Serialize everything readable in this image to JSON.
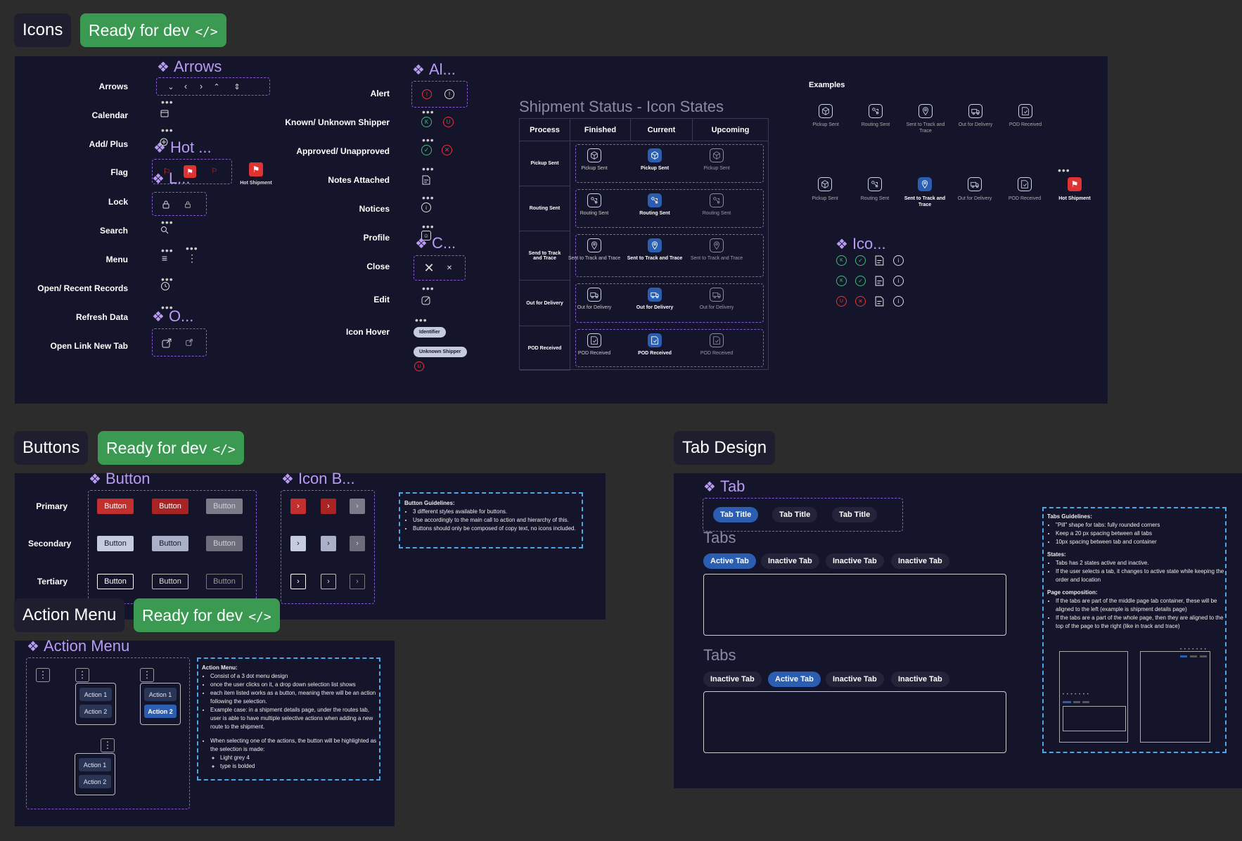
{
  "sections": {
    "icons": {
      "title": "Icons",
      "ready": "Ready for dev",
      "code": "</>"
    },
    "buttons": {
      "title": "Buttons",
      "ready": "Ready for dev",
      "code": "</>"
    },
    "action_menu": {
      "title": "Action Menu",
      "ready": "Ready for dev",
      "code": "</>"
    },
    "tab_design": {
      "title": "Tab Design"
    }
  },
  "icons_panel": {
    "components": {
      "arrows": "Arrows",
      "hot": "Hot ...",
      "lock": "L...",
      "open": "O...",
      "alert": "Al...",
      "close": "C...",
      "ico": "Ico..."
    },
    "left_labels": [
      "Arrows",
      "Calendar",
      "Add/ Plus",
      "Flag",
      "Lock",
      "Search",
      "Menu",
      "Open/ Recent Records",
      "Refresh Data",
      "Open Link New Tab"
    ],
    "mid_labels": [
      "Alert",
      "Known/ Unknown Shipper",
      "Approved/ Unapproved",
      "Notes Attached",
      "Notices",
      "Profile",
      "Close",
      "Edit",
      "Icon Hover"
    ],
    "hot_shipment": "Hot Shipment",
    "hover_tags": [
      "Identifier",
      "Unknown Shipper"
    ],
    "badge_u": "U",
    "badge_k": "K"
  },
  "shipment": {
    "title": "Shipment Status - Icon States",
    "headers": [
      "Process",
      "Finished",
      "Current",
      "Upcoming"
    ],
    "rows": [
      {
        "process": "Pickup Sent",
        "label": "Pickup Sent"
      },
      {
        "process": "Routing Sent",
        "label": "Routing Sent"
      },
      {
        "process": "Send to Track and Trace",
        "label": "Sent to Track and Trace"
      },
      {
        "process": "Out for Delivery",
        "label": "Out for Delivery"
      },
      {
        "process": "POD Received",
        "label": "POD Received"
      }
    ]
  },
  "examples": {
    "title": "Examples",
    "row1": [
      "Pickup Sent",
      "Routing Sent",
      "Sent to Track and Trace",
      "Out for Delivery",
      "POD Received"
    ],
    "row2": [
      "Pickup Sent",
      "Routing Sent",
      "Sent to Track and Trace",
      "Out for Delivery",
      "POD Received",
      "Hot Shipment"
    ]
  },
  "buttons_panel": {
    "component": "Button",
    "icon_component": "Icon B...",
    "rows": [
      "Primary",
      "Secondary",
      "Tertiary"
    ],
    "label": "Button",
    "chevron": "›",
    "guidelines_title": "Button Guidelines:",
    "guidelines": [
      "3 different styles available for buttons.",
      "Use accordingly to the main call to action and hierarchy of this.",
      "Buttons should only be composed of copy text, no icons included."
    ]
  },
  "action_panel": {
    "component": "Action Menu",
    "items": [
      "Action 1",
      "Action 2"
    ],
    "kebab": "⋮",
    "guidelines_title": "Action Menu:",
    "guidelines": [
      "Consist of a 3 dot menu design",
      "once the user clicks on it, a drop down selection list shows",
      "each item listed works as a button, meaning there will be an action following the selection.",
      "Example case: in a shipment details page, under the routes tab, user is able to have multiple selective actions when adding a new route to the shipment.",
      "When selecting one of the actions, the button will be highlighted as the selection is made:"
    ],
    "sub": [
      "Light grey 4",
      "type is bolded"
    ]
  },
  "tab_panel": {
    "component": "Tab",
    "tab_title": "Tab Title",
    "tabs_heading": "Tabs",
    "active": "Active Tab",
    "inactive": "Inactive Tab",
    "guide": {
      "title": "Tabs Guidelines:",
      "items": [
        "\"Pill\" shape for tabs: fully rounded corners",
        "Keep a 20 px spacing between all tabs",
        "10px spacing between tab and container"
      ],
      "states_title": "States:",
      "states": [
        "Tabs has 2 states active and inactive.",
        "If the user selects a tab, it changes to active state while keeping the order and location"
      ],
      "page_title": "Page composition:",
      "page": [
        "If the tabs are part of the middle page tab container, these will be aligned to the left (example is shipment details page)",
        "If the tabs are a part of the whole page, then they are aligned to the top of the page to the right (like in track and trace)"
      ]
    }
  }
}
